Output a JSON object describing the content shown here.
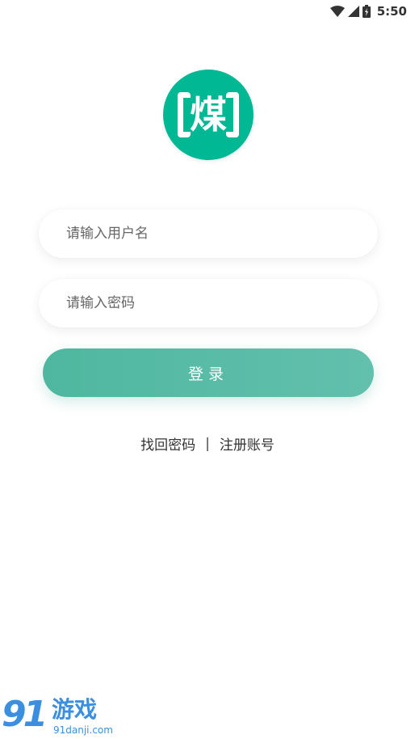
{
  "status_bar": {
    "time": "5:50",
    "icons": [
      "wifi-icon",
      "cell-signal-icon",
      "battery-charging-icon"
    ]
  },
  "logo": {
    "character": "煤",
    "color": "#00b894"
  },
  "form": {
    "username_placeholder": "请输入用户名",
    "username_value": "",
    "password_placeholder": "请输入密码",
    "password_value": "",
    "login_label": "登录"
  },
  "links": {
    "forgot_password": "找回密码",
    "separator": "|",
    "register": "注册账号"
  },
  "watermark": {
    "number": "91",
    "text": "游戏",
    "url": "91danji.com"
  },
  "colors": {
    "accent": "#00b894",
    "button_start": "#4fb79f",
    "button_end": "#62c0ad",
    "watermark": "#3b8fe0"
  }
}
